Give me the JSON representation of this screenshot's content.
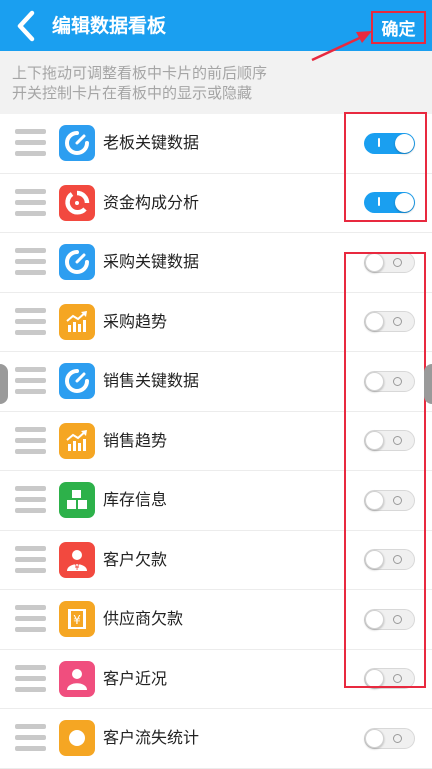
{
  "header": {
    "title": "编辑数据看板",
    "confirm_label": "确定"
  },
  "hint": {
    "line1": "上下拖动可调整看板中卡片的前后顺序",
    "line2": "开关控制卡片在看板中的显示或隐藏"
  },
  "rows": [
    {
      "label": "老板关键数据",
      "icon": "gauge-icon",
      "color": "#2d9ef0",
      "enabled": true
    },
    {
      "label": "资金构成分析",
      "icon": "donut-chart-icon",
      "color": "#f2493f",
      "enabled": true
    },
    {
      "label": "采购关键数据",
      "icon": "gauge-icon",
      "color": "#2d9ef0",
      "enabled": false
    },
    {
      "label": "采购趋势",
      "icon": "trend-chart-icon",
      "color": "#f5a623",
      "enabled": false
    },
    {
      "label": "销售关键数据",
      "icon": "gauge-icon",
      "color": "#2d9ef0",
      "enabled": false
    },
    {
      "label": "销售趋势",
      "icon": "trend-chart-icon",
      "color": "#f5a623",
      "enabled": false
    },
    {
      "label": "库存信息",
      "icon": "inventory-blocks-icon",
      "color": "#2db14a",
      "enabled": false
    },
    {
      "label": "客户欠款",
      "icon": "customer-debt-icon",
      "color": "#f2493f",
      "enabled": false
    },
    {
      "label": "供应商欠款",
      "icon": "supplier-debt-icon",
      "color": "#f5a623",
      "enabled": false
    },
    {
      "label": "客户近况",
      "icon": "customer-person-icon",
      "color": "#f04e7e",
      "enabled": false
    },
    {
      "label": "客户流失统计",
      "icon": "customer-churn-icon",
      "color": "#f5a623",
      "enabled": false
    }
  ],
  "colors": {
    "header": "#1a9ff0",
    "annotation": "#e8293f",
    "switch_on": "#1a9ff0"
  }
}
